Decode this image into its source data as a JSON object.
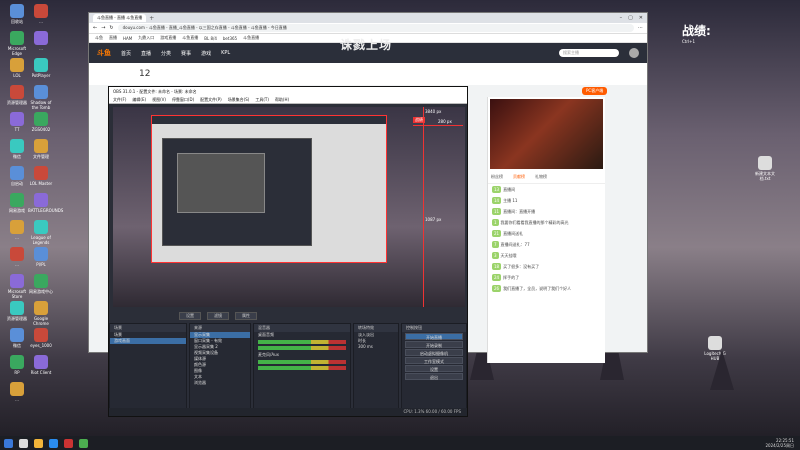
{
  "desktop": {
    "icons_left": [
      "回收站",
      "Microsoft Edge",
      "LOL",
      "资源管理器",
      "TT",
      "微信",
      "自启动",
      "网易游戏",
      "...",
      "...",
      "Microsoft Store",
      "资源管理器",
      "微信",
      "RP",
      "...",
      "...",
      "...",
      "PotPlayer",
      "Shadow of the Tomb",
      "ZGS0402",
      "文件管理",
      "LOL Master",
      "BATTLEGROUNDS",
      "League of Legends",
      "Pl/PL",
      "网易游戏中心",
      "Google Chrome",
      "eyes_1000",
      "Riot Client"
    ],
    "icons_right": [
      "新建文本文档.txt",
      "Logitech G HUB"
    ],
    "overlay_label": "战绩:",
    "overlay_sub": "Ctrl+1"
  },
  "browser": {
    "tab_label": "斗鱼直播 - 直播 斗鱼直播",
    "url": "douyu.com - 斗鱼直播 - 直播_斗鱼直播 - 以三国之存直播 - 斗鱼直播 - 斗鱼直播 - 今日直播",
    "bookmarks": [
      "斗鱼",
      "直播",
      "HAM",
      "九鼎入口",
      "游戏直播",
      "斗鱼直播",
      "BL 8/4",
      "bet365",
      "斗鱼直播"
    ],
    "nav": [
      "首页",
      "直播",
      "分类",
      "赛事",
      "游戏",
      "KPL"
    ],
    "search_placeholder": "搜索主播",
    "banner": "诛戮上场",
    "room_number": "12",
    "pc_client": "PC客户端",
    "chat_tabs": [
      "粉丝榜",
      "贡献榜",
      "礼物榜"
    ],
    "chat": [
      {
        "badge": "13",
        "text": "直播间"
      },
      {
        "badge": "14",
        "text": "主播 11"
      },
      {
        "badge": "11",
        "text": "直播间：直播开播"
      },
      {
        "badge": "1",
        "text": "我要你们看看我直播的那个精彩的高光"
      },
      {
        "badge": "21",
        "text": "直播间送礼"
      },
      {
        "badge": "7",
        "text": "直播间送礼：77"
      },
      {
        "badge": "3",
        "text": "天天挂哦"
      },
      {
        "badge": "18",
        "text": "买了很多：没有买了"
      },
      {
        "badge": "24",
        "text": "挥手的了"
      },
      {
        "badge": "26",
        "text": "我们直播了，全员，说明了我们个好人"
      }
    ]
  },
  "obs": {
    "title": "OBS 31.0.1 - 配置文件: 未命名 - 场景: 未命名",
    "menu": [
      "文件(F)",
      "编辑(E)",
      "视图(V)",
      "停靠窗口(D)",
      "配置文件(P)",
      "场景集合(S)",
      "工具(T)",
      "帮助(H)"
    ],
    "preview_label_top": "3840 px",
    "preview_label_mid": "1087 px",
    "preview_label_right": "280 px",
    "preview_label_inner": "战绩",
    "toolbar": [
      "设置",
      "滤镜",
      "属性"
    ],
    "docks": {
      "scenes": {
        "title": "场景",
        "items": [
          "场景",
          "游戏画面"
        ]
      },
      "sources": {
        "title": "来源",
        "items": [
          "显示采集",
          "窗口采集 - 有效",
          "显示器采集 2",
          "视频采集设备",
          "媒体源",
          "颜色源",
          "图像",
          "文本",
          "浏览器"
        ]
      },
      "mixer": {
        "title": "混音器",
        "items": [
          "桌面音频",
          "麦克风/Aux"
        ]
      },
      "transitions": {
        "title": "转场特效",
        "fade": "淡入淡出",
        "duration_label": "时长",
        "duration": "300 ms"
      },
      "controls": {
        "title": "控制按钮",
        "buttons": [
          "开始直播",
          "开始录制",
          "启动虚拟摄像机",
          "工作室模式",
          "设置",
          "退出"
        ]
      }
    },
    "status": "CPU: 1.3%  60.00 / 60.00 FPS"
  },
  "taskbar": {
    "time": "22:25:51",
    "date": "2024/2/25周日"
  }
}
